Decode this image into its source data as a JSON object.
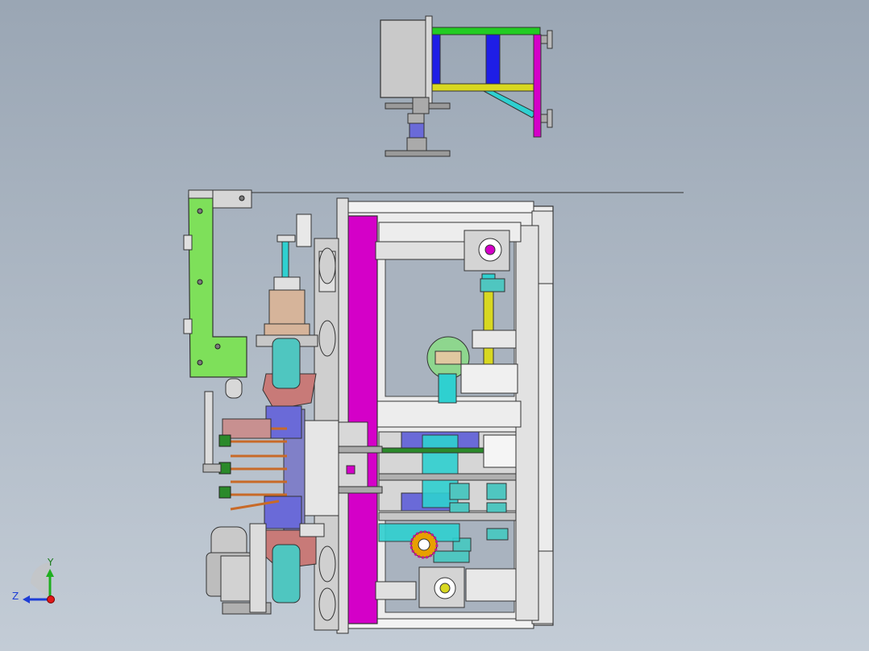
{
  "viewport": {
    "background_top": "#9aa6b4",
    "background_bottom": "#c3ccd6"
  },
  "colors": {
    "magenta": "#d400c8",
    "green_bracket": "#7ee05a",
    "frame_grey": "#e8e8e8",
    "cyan": "#2fd0d0",
    "teal_gear": "#4fc6c0",
    "salmon": "#c87a78",
    "blue": "#1e1ee6",
    "yellow": "#d8d820",
    "green_bar": "#22cc22",
    "tan": "#d6b49a",
    "olive": "#c8c86a"
  },
  "triad": {
    "x_label": "",
    "y_label": "Y",
    "z_label": "Z"
  }
}
